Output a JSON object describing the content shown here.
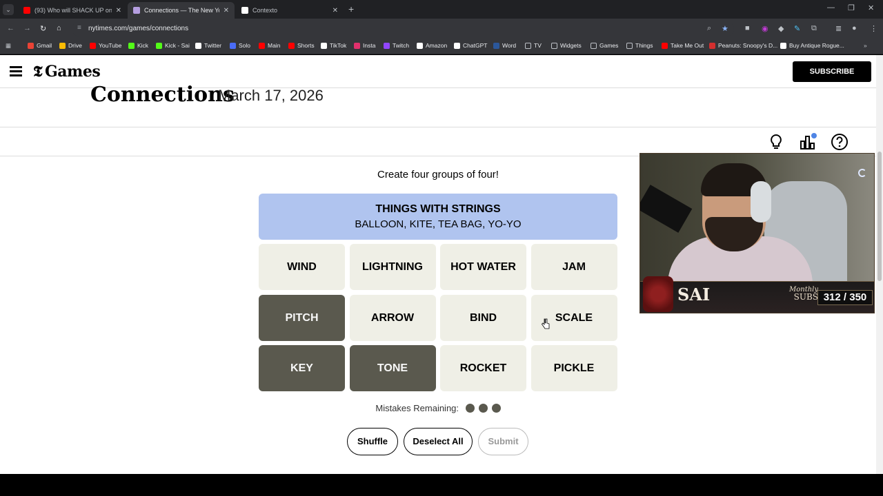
{
  "browser": {
    "tabs": [
      {
        "title": "(93) Who will SHACK UP on the",
        "favicon": "#ff0000",
        "active": false
      },
      {
        "title": "Connections — The New York T",
        "favicon": "#b59ee0",
        "active": true
      },
      {
        "title": "Contexto",
        "favicon": "#ffffff",
        "active": false
      }
    ],
    "url": "nytimes.com/games/connections",
    "bookmarks": [
      {
        "label": "Gmail",
        "color": "#ea4335"
      },
      {
        "label": "Drive",
        "color": "#fbbc04"
      },
      {
        "label": "YouTube",
        "color": "#ff0000"
      },
      {
        "label": "Kick",
        "color": "#53fc18"
      },
      {
        "label": "Kick - Sai",
        "color": "#53fc18"
      },
      {
        "label": "Twitter",
        "color": "#ffffff"
      },
      {
        "label": "Solo",
        "color": "#4a6cf7"
      },
      {
        "label": "Main",
        "color": "#ff0000"
      },
      {
        "label": "Shorts",
        "color": "#ff0000"
      },
      {
        "label": "TikTok",
        "color": "#ffffff"
      },
      {
        "label": "Insta",
        "color": "#e1306c"
      },
      {
        "label": "Twitch",
        "color": "#9146ff"
      },
      {
        "label": "Amazon",
        "color": "#ffffff"
      },
      {
        "label": "ChatGPT",
        "color": "#ffffff"
      },
      {
        "label": "Word",
        "color": "#2b579a"
      },
      {
        "label": "TV",
        "color": "#bdc1c6"
      },
      {
        "label": "Widgets",
        "color": "#bdc1c6"
      },
      {
        "label": "Games",
        "color": "#bdc1c6"
      },
      {
        "label": "Things",
        "color": "#bdc1c6"
      },
      {
        "label": "Take Me Out",
        "color": "#ff0000"
      },
      {
        "label": "Peanuts: Snoopy's D...",
        "color": "#d32f2f"
      },
      {
        "label": "Buy Antique Rogue...",
        "color": "#ffffff"
      }
    ]
  },
  "header": {
    "logo": "Games",
    "subscribe": "SUBSCRIBE"
  },
  "game": {
    "name": "Connections",
    "date": "March 17, 2026",
    "instructions": "Create four groups of four!",
    "solved": {
      "category": "THINGS WITH STRINGS",
      "words": "BALLOON, KITE, TEA BAG, YO-YO",
      "color": "#b0c4ef"
    },
    "tiles": [
      {
        "word": "WIND",
        "selected": false
      },
      {
        "word": "LIGHTNING",
        "selected": false
      },
      {
        "word": "HOT WATER",
        "selected": false
      },
      {
        "word": "JAM",
        "selected": false
      },
      {
        "word": "PITCH",
        "selected": true
      },
      {
        "word": "ARROW",
        "selected": false
      },
      {
        "word": "BIND",
        "selected": false
      },
      {
        "word": "SCALE",
        "selected": false
      },
      {
        "word": "KEY",
        "selected": true
      },
      {
        "word": "TONE",
        "selected": true
      },
      {
        "word": "ROCKET",
        "selected": false
      },
      {
        "word": "PICKLE",
        "selected": false
      }
    ],
    "mistakes_label": "Mistakes Remaining:",
    "mistakes_remaining": 3,
    "buttons": {
      "shuffle": "Shuffle",
      "deselect": "Deselect All",
      "submit": "Submit"
    }
  },
  "stream_overlay": {
    "name": "SAI",
    "monthly": "Monthly",
    "subs": "SUBS",
    "count": "312 / 350"
  }
}
